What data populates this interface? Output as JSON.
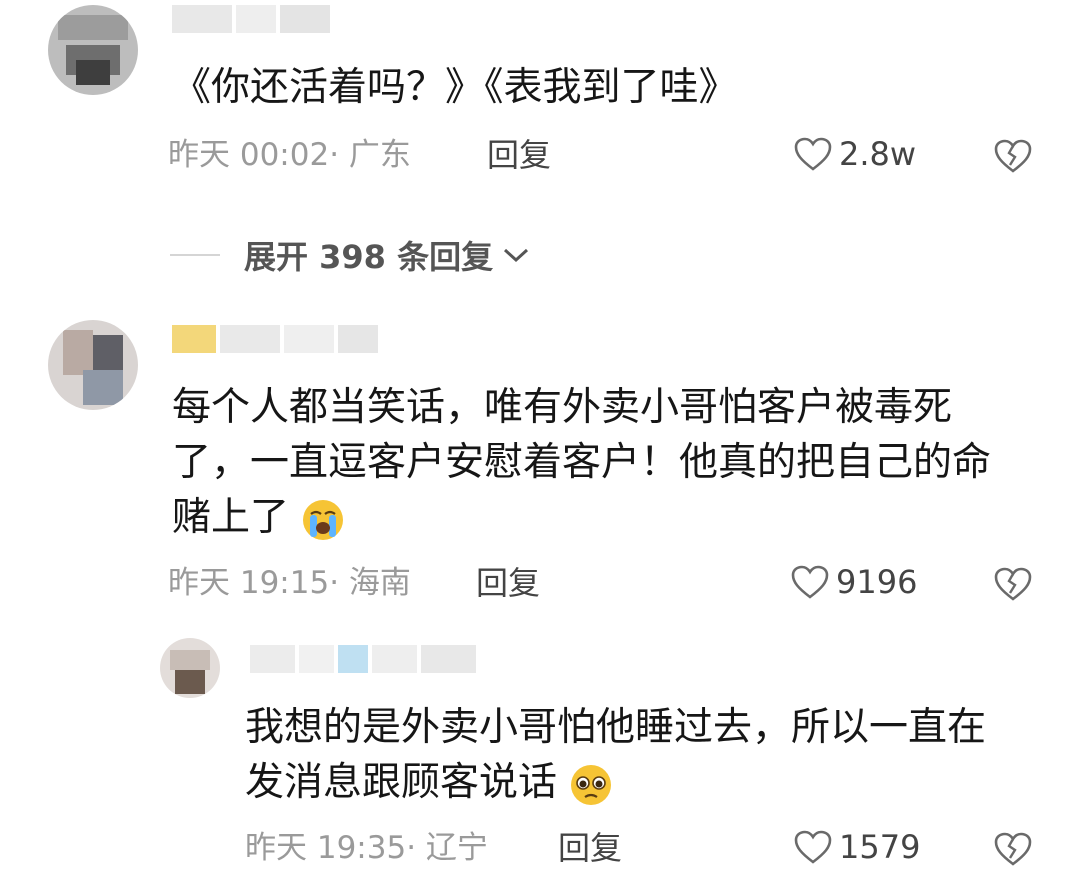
{
  "comments": [
    {
      "text": "《你还活着吗？》《表我到了哇》",
      "time": "昨天 00:02",
      "location": "广东",
      "reply_label": "回复",
      "likes": "2.8w",
      "expand_label": "展开 398 条回复"
    },
    {
      "text": "每个人都当笑话，唯有外卖小哥怕客户被毒死了，一直逗客户安慰着客户！他真的把自己的命赌上了",
      "emoji": "loudly-crying-face",
      "time": "昨天 19:15",
      "location": "海南",
      "reply_label": "回复",
      "likes": "9196"
    },
    {
      "text": "我想的是外卖小哥怕他睡过去，所以一直在发消息跟顾客说话",
      "emoji": "pleading-face",
      "time": "昨天 19:35",
      "location": "辽宁",
      "reply_label": "回复",
      "likes": "1579"
    }
  ],
  "meta_separator": "· ",
  "colors": {
    "meta": "#9a9a9a",
    "text": "#161616",
    "emoji": "#f6c435"
  }
}
